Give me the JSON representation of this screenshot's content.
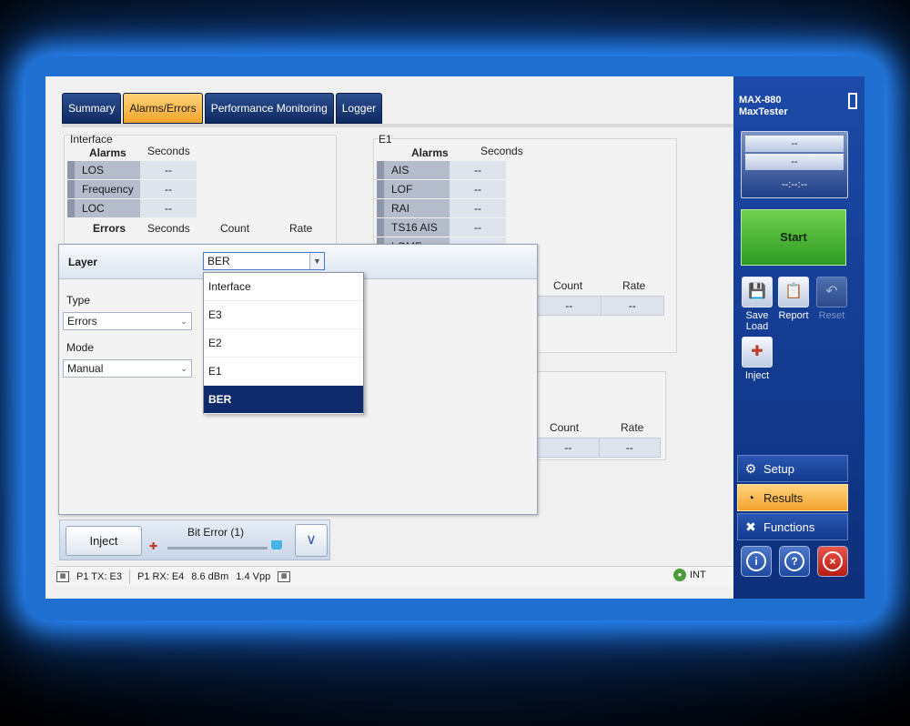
{
  "tabs": [
    {
      "label": "Summary",
      "active": false
    },
    {
      "label": "Alarms/Errors",
      "active": true
    },
    {
      "label": "Performance Monitoring",
      "active": false
    },
    {
      "label": "Logger",
      "active": false
    }
  ],
  "interface_panel": {
    "title": "Interface",
    "alarms_header": "Alarms",
    "seconds_header": "Seconds",
    "alarms": [
      {
        "label": "LOS",
        "seconds": "--"
      },
      {
        "label": "Frequency",
        "seconds": "--"
      },
      {
        "label": "LOC",
        "seconds": "--"
      }
    ],
    "errors_header": "Errors",
    "errors_seconds_header": "Seconds",
    "count_header": "Count",
    "rate_header": "Rate"
  },
  "e1_panel": {
    "title": "E1",
    "alarms_header": "Alarms",
    "seconds_header": "Seconds",
    "alarms": [
      {
        "label": "AIS",
        "seconds": "--"
      },
      {
        "label": "LOF",
        "seconds": "--"
      },
      {
        "label": "RAI",
        "seconds": "--"
      },
      {
        "label": "TS16 AIS",
        "seconds": "--"
      },
      {
        "label": "LOMF",
        "seconds": "--"
      }
    ],
    "errors_count_header": "Count",
    "errors_rate_header": "Rate",
    "errors_count": "--",
    "errors_rate": "--"
  },
  "second_panel": {
    "count_header": "Count",
    "rate_header": "Rate",
    "count": "--",
    "rate": "--"
  },
  "dialog": {
    "title": "Layer",
    "layer_value": "BER",
    "type_label": "Type",
    "type_value": "Errors",
    "mode_label": "Mode",
    "mode_value": "Manual",
    "options": [
      "Interface",
      "E3",
      "E2",
      "E1",
      "BER"
    ],
    "selected": "BER"
  },
  "inject_bar": {
    "inject_label": "Inject",
    "error_label": "Bit Error (1)"
  },
  "status_bar": {
    "tx": "P1 TX: E3",
    "rx": "P1 RX: E4",
    "power": "8.6 dBm",
    "vpp": "1.4 Vpp",
    "clock": "INT"
  },
  "sidebar": {
    "model_line1": "MAX-880",
    "model_line2": "MaxTester",
    "status_line1": "--",
    "status_line2": "--",
    "timer": "--:--:--",
    "start_label": "Start",
    "save_label": "Save",
    "load_label": "Load",
    "report_label": "Report",
    "reset_label": "Reset",
    "inject_label": "Inject",
    "nav": [
      {
        "label": "Setup",
        "active": false
      },
      {
        "label": "Results",
        "active": true
      },
      {
        "label": "Functions",
        "active": false
      }
    ]
  },
  "colors": {
    "accent_orange": "#f2a62c",
    "nav_blue": "#123a8e",
    "start_green": "#2f9a23",
    "selected_option": "#0f2a6b"
  }
}
